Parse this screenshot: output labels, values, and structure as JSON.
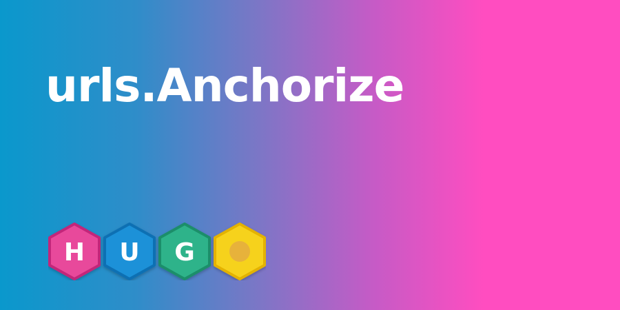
{
  "page": {
    "title": "urls.Anchorize"
  },
  "logo": {
    "name": "hugo-logo",
    "letters": [
      "H",
      "U",
      "G",
      "O"
    ],
    "colors": {
      "H": {
        "fill": "#e84a9b",
        "edge": "#c2257a",
        "glyph": "#ffffff"
      },
      "U": {
        "fill": "#1f91d8",
        "edge": "#0e6fb3",
        "glyph": "#ffffff"
      },
      "G": {
        "fill": "#2fb38a",
        "edge": "#1a8e6a",
        "glyph": "#ffffff"
      },
      "O": {
        "fill": "#f6d21f",
        "edge": "#e3b200",
        "glyph": "#e7b23b"
      }
    }
  },
  "colors": {
    "gradient_start": "#0a98cc",
    "gradient_end": "#ff4dc0",
    "text": "#ffffff"
  }
}
